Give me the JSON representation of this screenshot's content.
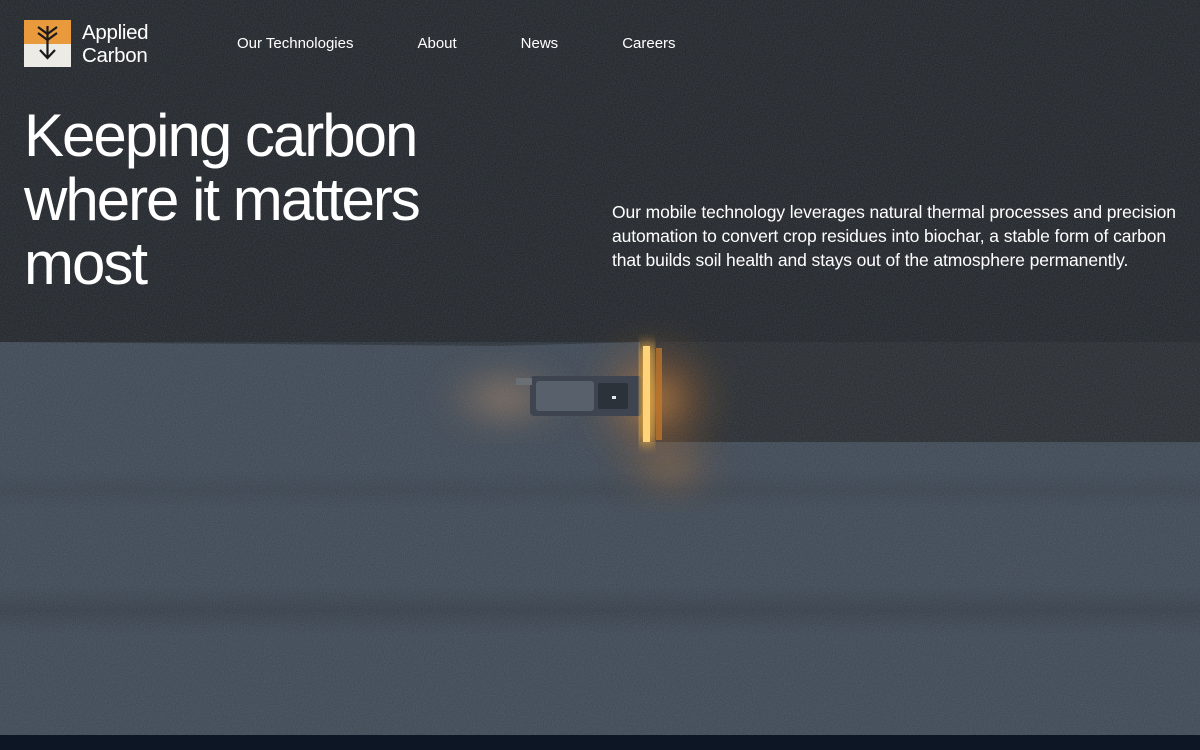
{
  "brand": {
    "name_line1": "Applied",
    "name_line2": "Carbon",
    "logo_icon": "wheat-arrow-down-icon",
    "logo_colors": {
      "top": "#e89a3c",
      "bottom": "#ecebe6",
      "stroke": "#1a1a1a"
    }
  },
  "nav": {
    "items": [
      {
        "label": "Our Technologies"
      },
      {
        "label": "About"
      },
      {
        "label": "News"
      },
      {
        "label": "Careers"
      }
    ]
  },
  "hero": {
    "headline_lines": [
      "Keeping carbon",
      "where it matters",
      "most"
    ],
    "lede": "Our mobile technology leverages natural thermal processes and precision automation to convert crop residues into biochar, a stable form of carbon that builds soil health and stays out of the atmosphere permanently.",
    "image_subject": "aerial view of tractor machine working a field at dusk"
  },
  "colors": {
    "text": "#ffffff",
    "accent_orange": "#e89a3c",
    "footer_strip": "#0c1624"
  }
}
